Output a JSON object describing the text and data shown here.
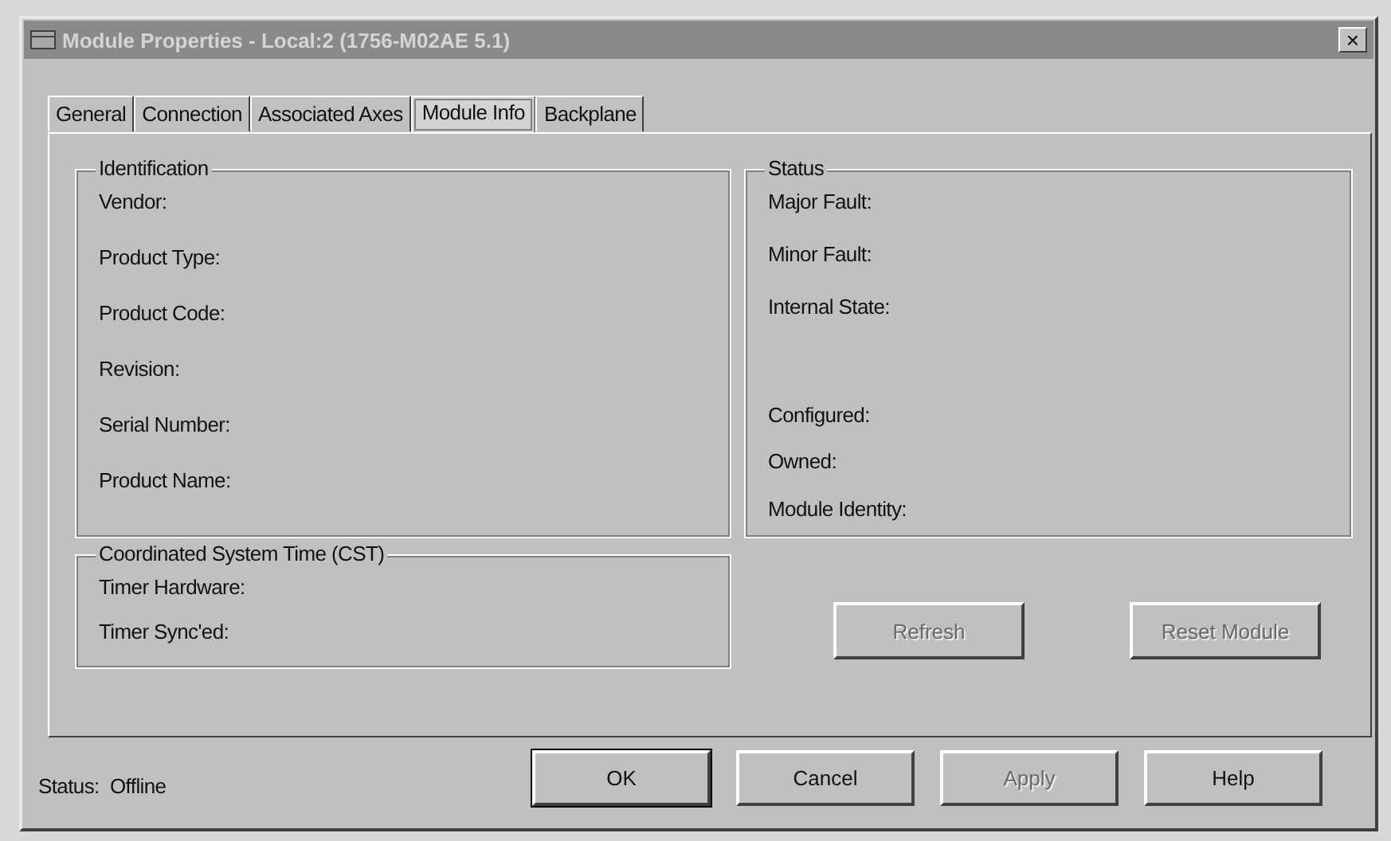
{
  "window": {
    "title": "Module Properties - Local:2 (1756-M02AE 5.1)",
    "close": "×"
  },
  "tabs": [
    {
      "label": "General",
      "selected": false
    },
    {
      "label": "Connection",
      "selected": false
    },
    {
      "label": "Associated Axes",
      "selected": false
    },
    {
      "label": "Module Info",
      "selected": true
    },
    {
      "label": "Backplane",
      "selected": false
    }
  ],
  "identification": {
    "title": "Identification",
    "items": [
      "Vendor:",
      "Product Type:",
      "Product Code:",
      "Revision:",
      "Serial Number:",
      "Product Name:"
    ]
  },
  "status": {
    "title": "Status",
    "fault_items": [
      "Major Fault:",
      "Minor Fault:",
      "Internal State:"
    ],
    "ownership_items": [
      "Configured:",
      "Owned:",
      "Module Identity:"
    ]
  },
  "cst": {
    "title": "Coordinated System Time (CST)",
    "items": [
      "Timer Hardware:",
      "Timer Sync'ed:"
    ]
  },
  "panel_buttons": [
    {
      "label": "Refresh",
      "disabled": true
    },
    {
      "label": "Reset Module",
      "disabled": true
    }
  ],
  "status_bar": {
    "label": "Status:",
    "value": "Offline"
  },
  "buttons": [
    {
      "label": "OK",
      "disabled": false,
      "default": true
    },
    {
      "label": "Cancel",
      "disabled": false,
      "default": false
    },
    {
      "label": "Apply",
      "disabled": true,
      "default": false
    },
    {
      "label": "Help",
      "disabled": false,
      "default": false
    }
  ]
}
